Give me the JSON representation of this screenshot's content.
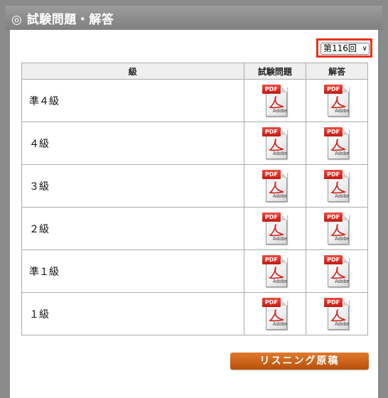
{
  "header": {
    "title": "◎ 試験問題・解答"
  },
  "session_select": {
    "value": "第116回"
  },
  "table": {
    "headers": {
      "grade": "級",
      "questions": "試験問題",
      "answers": "解答"
    },
    "rows": [
      {
        "grade": "準４級"
      },
      {
        "grade": "４級"
      },
      {
        "grade": "３級"
      },
      {
        "grade": "２級"
      },
      {
        "grade": "準１級"
      },
      {
        "grade": "１級"
      }
    ]
  },
  "pdf_icon": {
    "tag": "PDF",
    "brand": "Adobe",
    "icon_name": "pdf-file-icon",
    "tag_color": "#e2271c"
  },
  "listening_button": {
    "label": "リスニング原稿",
    "color": "#c9621a"
  },
  "colors": {
    "frame": "#8a8a8a",
    "highlight_border": "#e8321e"
  }
}
